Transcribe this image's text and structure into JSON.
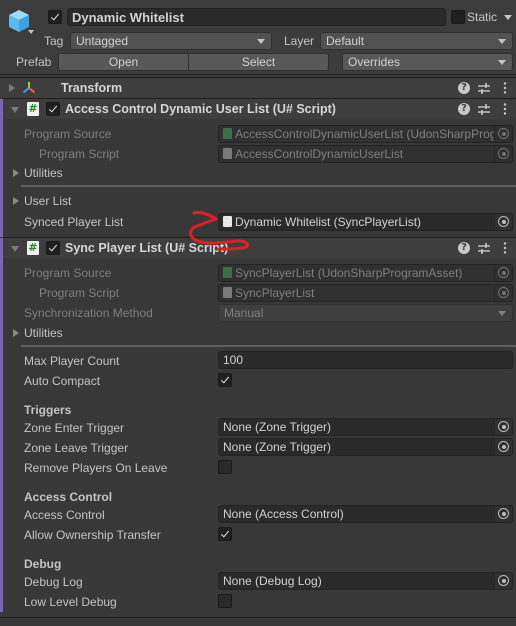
{
  "header": {
    "active": true,
    "object_name": "Dynamic Whitelist",
    "static_label": "Static",
    "static_checked": false,
    "tag_label": "Tag",
    "tag_value": "Untagged",
    "layer_label": "Layer",
    "layer_value": "Default",
    "prefab_label": "Prefab",
    "open_button": "Open",
    "select_button": "Select",
    "overrides_dropdown": "Overrides"
  },
  "components": {
    "transform": {
      "title": "Transform"
    },
    "access_control": {
      "title": "Access Control Dynamic User List (U# Script)",
      "enabled": true,
      "program_source_label": "Program Source",
      "program_source_value": "AccessControlDynamicUserList (UdonSharpProgramAsset)",
      "program_script_label": "Program Script",
      "program_script_value": "AccessControlDynamicUserList",
      "utilities_label": "Utilities",
      "user_list_label": "User List",
      "synced_player_list_label": "Synced Player List",
      "synced_player_list_value": "Dynamic Whitelist (SyncPlayerList)"
    },
    "sync_player_list": {
      "title": "Sync Player List (U# Script)",
      "enabled": true,
      "program_source_label": "Program Source",
      "program_source_value": "SyncPlayerList (UdonSharpProgramAsset)",
      "program_script_label": "Program Script",
      "program_script_value": "SyncPlayerList",
      "sync_method_label": "Synchronization Method",
      "sync_method_value": "Manual",
      "utilities_label": "Utilities",
      "max_player_count_label": "Max Player Count",
      "max_player_count_value": "100",
      "auto_compact_label": "Auto Compact",
      "auto_compact": true,
      "triggers_heading": "Triggers",
      "zone_enter_label": "Zone Enter Trigger",
      "zone_enter_value": "None (Zone Trigger)",
      "zone_leave_label": "Zone Leave Trigger",
      "zone_leave_value": "None (Zone Trigger)",
      "remove_players_label": "Remove Players On Leave",
      "remove_players": false,
      "access_heading": "Access Control",
      "access_control_label": "Access Control",
      "access_control_value": "None (Access Control)",
      "allow_ownership_label": "Allow Ownership Transfer",
      "allow_ownership": true,
      "debug_heading": "Debug",
      "debug_log_label": "Debug Log",
      "debug_log_value": "None (Debug Log)",
      "low_level_debug_label": "Low Level Debug",
      "low_level_debug": false
    }
  },
  "icons": {
    "help": "?",
    "script": "#"
  },
  "colors": {
    "accent_bar": "#7a66b5",
    "annotation": "#e02020",
    "gameobject_icon": "#6cc4f0"
  }
}
